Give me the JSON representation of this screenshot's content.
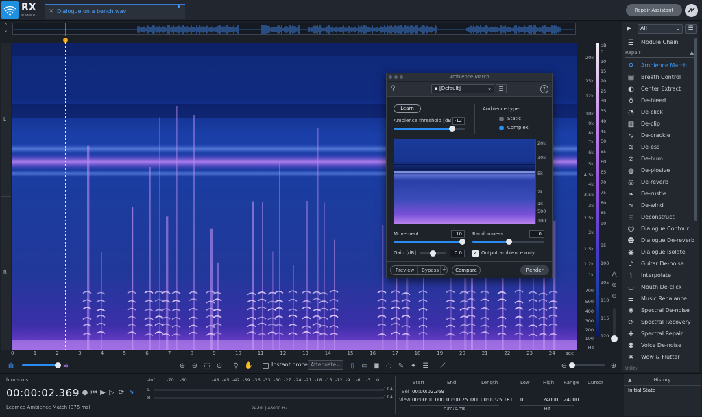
{
  "app": {
    "logo_text": "RX",
    "logo_sub": "ADVANCED",
    "tab_name": "Dialogue on a bench.wav",
    "repair_assistant": "Repair Assistant"
  },
  "channels": {
    "left": "L",
    "right": "R"
  },
  "time_axis": {
    "unit": "sec",
    "ticks": [
      "0",
      "1",
      "2",
      "3",
      "4",
      "5",
      "6",
      "7",
      "8",
      "9",
      "10",
      "11",
      "12",
      "13",
      "14",
      "15",
      "16",
      "17",
      "18",
      "19",
      "20",
      "21",
      "22",
      "23",
      "24"
    ]
  },
  "freq_axis": {
    "unit": "Hz",
    "ticks": [
      "20k",
      "15k",
      "12k",
      "10k",
      "9k",
      "8k",
      "7k",
      "6k",
      "5k",
      "4.5k",
      "4k",
      "3.5k",
      "3k",
      "2.5k",
      "2k",
      "1.5k",
      "1.2k",
      "1k",
      "700",
      "500",
      "400",
      "300",
      "200",
      "100"
    ]
  },
  "db_axis": {
    "unit": "dB",
    "ticks": [
      "0",
      "10",
      "15",
      "20",
      "25",
      "30",
      "35",
      "40",
      "45",
      "50",
      "55",
      "60",
      "65",
      "70",
      "75",
      "80",
      "85",
      "90",
      "95",
      "100",
      "105",
      "110",
      "115",
      "120"
    ]
  },
  "module_panel": {
    "filter": "All",
    "module_chain": "Module Chain",
    "section": "Repair",
    "modules": [
      {
        "name": "Ambience Match",
        "icon": "ambience-icon",
        "glyph": "⚲"
      },
      {
        "name": "Breath Control",
        "icon": "breath-icon",
        "glyph": "▤"
      },
      {
        "name": "Center Extract",
        "icon": "center-icon",
        "glyph": "◐"
      },
      {
        "name": "De-bleed",
        "icon": "debleed-icon",
        "glyph": "♁"
      },
      {
        "name": "De-click",
        "icon": "declick-icon",
        "glyph": "◔"
      },
      {
        "name": "De-clip",
        "icon": "declip-icon",
        "glyph": "▥"
      },
      {
        "name": "De-crackle",
        "icon": "decrackle-icon",
        "glyph": "∿"
      },
      {
        "name": "De-ess",
        "icon": "deess-icon",
        "glyph": "≋"
      },
      {
        "name": "De-hum",
        "icon": "dehum-icon",
        "glyph": "⊘"
      },
      {
        "name": "De-plosive",
        "icon": "deplosive-icon",
        "glyph": "◍"
      },
      {
        "name": "De-reverb",
        "icon": "dereverb-icon",
        "glyph": "◎"
      },
      {
        "name": "De-rustle",
        "icon": "derustle-icon",
        "glyph": "❧"
      },
      {
        "name": "De-wind",
        "icon": "dewind-icon",
        "glyph": "≈"
      },
      {
        "name": "Deconstruct",
        "icon": "deconstruct-icon",
        "glyph": "⊞"
      },
      {
        "name": "Dialogue Contour",
        "icon": "contour-icon",
        "glyph": "☺"
      },
      {
        "name": "Dialogue De-reverb",
        "icon": "dialogue-dereverb-icon",
        "glyph": "☻"
      },
      {
        "name": "Dialogue Isolate",
        "icon": "isolate-icon",
        "glyph": "◉"
      },
      {
        "name": "Guitar De-noise",
        "icon": "guitar-icon",
        "glyph": "♪"
      },
      {
        "name": "Interpolate",
        "icon": "interpolate-icon",
        "glyph": "⌇"
      },
      {
        "name": "Mouth De-click",
        "icon": "mouth-icon",
        "glyph": "◡"
      },
      {
        "name": "Music Rebalance",
        "icon": "rebalance-icon",
        "glyph": "⚌"
      },
      {
        "name": "Spectral De-noise",
        "icon": "spectral-denoise-icon",
        "glyph": "✺"
      },
      {
        "name": "Spectral Recovery",
        "icon": "recovery-icon",
        "glyph": "⟳"
      },
      {
        "name": "Spectral Repair",
        "icon": "spectral-repair-icon",
        "glyph": "✚"
      },
      {
        "name": "Voice De-noise",
        "icon": "voice-icon",
        "glyph": "⚉"
      },
      {
        "name": "Wow & Flutter",
        "icon": "wow-icon",
        "glyph": "❀"
      }
    ],
    "utility": "Utility"
  },
  "toolbar": {
    "instant_process": "Instant process",
    "attenuate": "Attenuate"
  },
  "transport": {
    "time_format": "h:m:s.ms",
    "time": "00:00:02.369",
    "status": "Learned Ambience Match (375 ms)"
  },
  "meter": {
    "scale": [
      "-Inf.",
      "-70",
      "-60",
      "-48",
      "-45",
      "-42",
      "-39",
      "-36",
      "-33",
      "-30",
      "-27",
      "-24",
      "-21",
      "-18",
      "-15",
      "-12",
      "-9",
      "-6",
      "-3",
      "0"
    ],
    "left": "L",
    "right": "R",
    "left_val": "-17.4",
    "right_val": "-17.4",
    "format": "24-bit | 48000 Hz"
  },
  "selection": {
    "headers": {
      "start": "Start",
      "end": "End",
      "length": "Length",
      "low": "Low",
      "high": "High",
      "range": "Range",
      "cursor": "Cursor"
    },
    "sel_label": "Sel",
    "view_label": "View",
    "sel_start": "00:00:02.369",
    "view_start": "00:00:00.000",
    "view_end": "00:00:25.181",
    "view_length": "00:00:25.181",
    "view_low": "0",
    "view_high": "24000",
    "view_range": "24000",
    "time_unit": "h:m:s.ms",
    "freq_unit": "Hz"
  },
  "history": {
    "title": "History",
    "item": "Initial State"
  },
  "dialog": {
    "title": "Ambience Match",
    "preset": "[Default]",
    "learn": "Learn",
    "threshold_label": "Ambience threshold [dB]",
    "threshold_value": "-12",
    "threshold_level": 0.82,
    "ambience_type": "Ambience type:",
    "static": "Static",
    "complex": "Complex",
    "selected_type": "Complex",
    "mini_freq": [
      "20k",
      "10k",
      "5k",
      "2k",
      "1k",
      "500",
      "100"
    ],
    "movement_label": "Movement",
    "movement_value": "10",
    "movement_level": 1.0,
    "randomness_label": "Randomness",
    "randomness_value": "0",
    "randomness_level": 0.5,
    "gain_label": "Gain [dB]",
    "gain_value": "0.0",
    "gain_level": 0.5,
    "output_only": "Output ambience only",
    "output_only_checked": true,
    "preview": "Preview",
    "bypass": "Bypass",
    "compare": "Compare",
    "render": "Render"
  }
}
